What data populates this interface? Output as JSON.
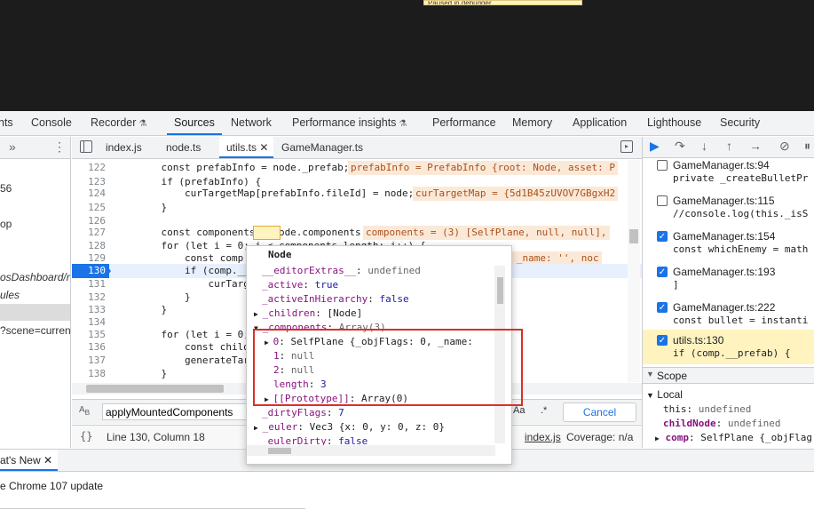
{
  "viewport": {
    "paused_text": "Paused in debugger"
  },
  "main_tabs": [
    {
      "label": "nts"
    },
    {
      "label": "Console"
    },
    {
      "label": "Recorder",
      "experimental": true
    },
    {
      "label": "Sources",
      "active": true
    },
    {
      "label": "Network"
    },
    {
      "label": "Performance insights",
      "experimental": true
    },
    {
      "label": "Performance"
    },
    {
      "label": "Memory"
    },
    {
      "label": "Application"
    },
    {
      "label": "Lighthouse"
    },
    {
      "label": "Security"
    }
  ],
  "left_nav": {
    "items": [
      "56",
      "op",
      "osDashboard/re",
      "ules",
      "?scene=current_"
    ]
  },
  "editor_tabs": [
    "index.js",
    "node.ts",
    "utils.ts",
    "GameManager.ts"
  ],
  "code": {
    "lines": [
      {
        "n": "122",
        "text": "    const prefabInfo = node._prefab;",
        "inline": "prefabInfo = PrefabInfo {root: Node, asset: P"
      },
      {
        "n": "123",
        "text": "    if (prefabInfo) {"
      },
      {
        "n": "124",
        "text": "        curTargetMap[prefabInfo.fileId] = node;",
        "inline": "curTargetMap = {5d1B45zUVOV7GBgxH2"
      },
      {
        "n": "125",
        "text": "    }"
      },
      {
        "n": "126",
        "text": ""
      },
      {
        "n": "127",
        "text": "    const components = node.components;",
        "inline": "components = (3) [SelfPlane, null, null],"
      },
      {
        "n": "128",
        "text": "    for (let i = 0; i < components.length; i++) {"
      },
      {
        "n": "129",
        "text": "        const comp = c",
        "inline": "0, _name: '', noc"
      },
      {
        "n": "130",
        "text": "        if (comp.__pre",
        "current": true
      },
      {
        "n": "131",
        "text": "            curTargetM"
      },
      {
        "n": "132",
        "text": "        }"
      },
      {
        "n": "133",
        "text": "    }"
      },
      {
        "n": "134",
        "text": ""
      },
      {
        "n": "135",
        "text": "    for (let i = 0; i"
      },
      {
        "n": "136",
        "text": "        const childNo"
      },
      {
        "n": "137",
        "text": "        generateTarget"
      },
      {
        "n": "138",
        "text": "    }"
      }
    ]
  },
  "search": {
    "value": "applyMountedComponents",
    "aa": "Aa",
    "regex": ".*",
    "cancel": "Cancel"
  },
  "status": {
    "position": "Line 130, Column 18",
    "from_prefix": "m",
    "from_file": "index.js",
    "coverage": "Coverage: n/a"
  },
  "breakpoints": [
    {
      "file": "GameManager.ts:94",
      "src": "private _createBulletPr",
      "checked": false
    },
    {
      "file": "GameManager.ts:115",
      "src": "//console.log(this._isS",
      "checked": false
    },
    {
      "file": "GameManager.ts:154",
      "src": "const whichEnemy = math",
      "checked": true
    },
    {
      "file": "GameManager.ts:193",
      "src": "]",
      "checked": true
    },
    {
      "file": "GameManager.ts:222",
      "src": "const bullet = instanti",
      "checked": true
    },
    {
      "file": "utils.ts:130",
      "src": "if (comp.__prefab) {",
      "checked": true,
      "selected": true
    }
  ],
  "scope": {
    "title": "Scope",
    "local": "Local",
    "vars": [
      {
        "key": "this",
        "val": "undefined"
      },
      {
        "key": "childNode",
        "val": "undefined"
      },
      {
        "key": "comp",
        "val": "SelfPlane {_objFlag"
      }
    ]
  },
  "popup": {
    "title": "Node",
    "rows": [
      {
        "key": "__editorExtras__",
        "val": "undefined",
        "indent": 0
      },
      {
        "key": "_active",
        "val": "true",
        "indent": 0
      },
      {
        "key": "_activeInHierarchy",
        "val": "false",
        "indent": 0
      },
      {
        "key": "_children",
        "val": "[Node]",
        "indent": 0,
        "arrow": "▶"
      },
      {
        "key": "_components",
        "val": "Array(3)",
        "indent": 0,
        "arrow": "▼"
      },
      {
        "key": "0",
        "val": "SelfPlane {_objFlags: 0, _name:",
        "indent": 1,
        "arrow": "▶"
      },
      {
        "key": "1",
        "val": "null",
        "indent": 1
      },
      {
        "key": "2",
        "val": "null",
        "indent": 1
      },
      {
        "key": "length",
        "val": "3",
        "indent": 1
      },
      {
        "key": "[[Prototype]]",
        "val": "Array(0)",
        "indent": 1,
        "arrow": "▶"
      },
      {
        "key": "_dirtyFlags",
        "val": "7",
        "indent": 0
      },
      {
        "key": "_euler",
        "val": "Vec3 {x: 0, y: 0, z: 0}",
        "indent": 0,
        "arrow": "▶"
      },
      {
        "key": "_eulerDirty",
        "val": "false",
        "indent": 0
      }
    ]
  },
  "drawer": {
    "tab": "at's New",
    "update_text": "e Chrome 107 update"
  },
  "colors": {
    "accent": "#1a73e8",
    "highlight_box": "#d93025",
    "inline_value_bg": "#fbe9d8"
  }
}
